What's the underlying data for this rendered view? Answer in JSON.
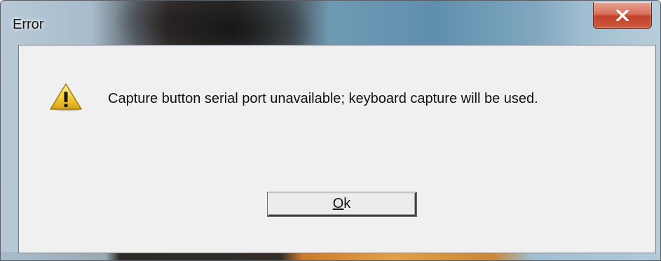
{
  "window": {
    "title": "Error"
  },
  "dialog": {
    "icon": "warning-icon",
    "message": "Capture button serial port unavailable; keyboard capture will be used.",
    "ok_button": {
      "mnemonic": "O",
      "rest": "k"
    }
  },
  "colors": {
    "client_background": "#f0f0f0",
    "close_button": "#c2412a",
    "warning_yellow": "#f2c230"
  }
}
